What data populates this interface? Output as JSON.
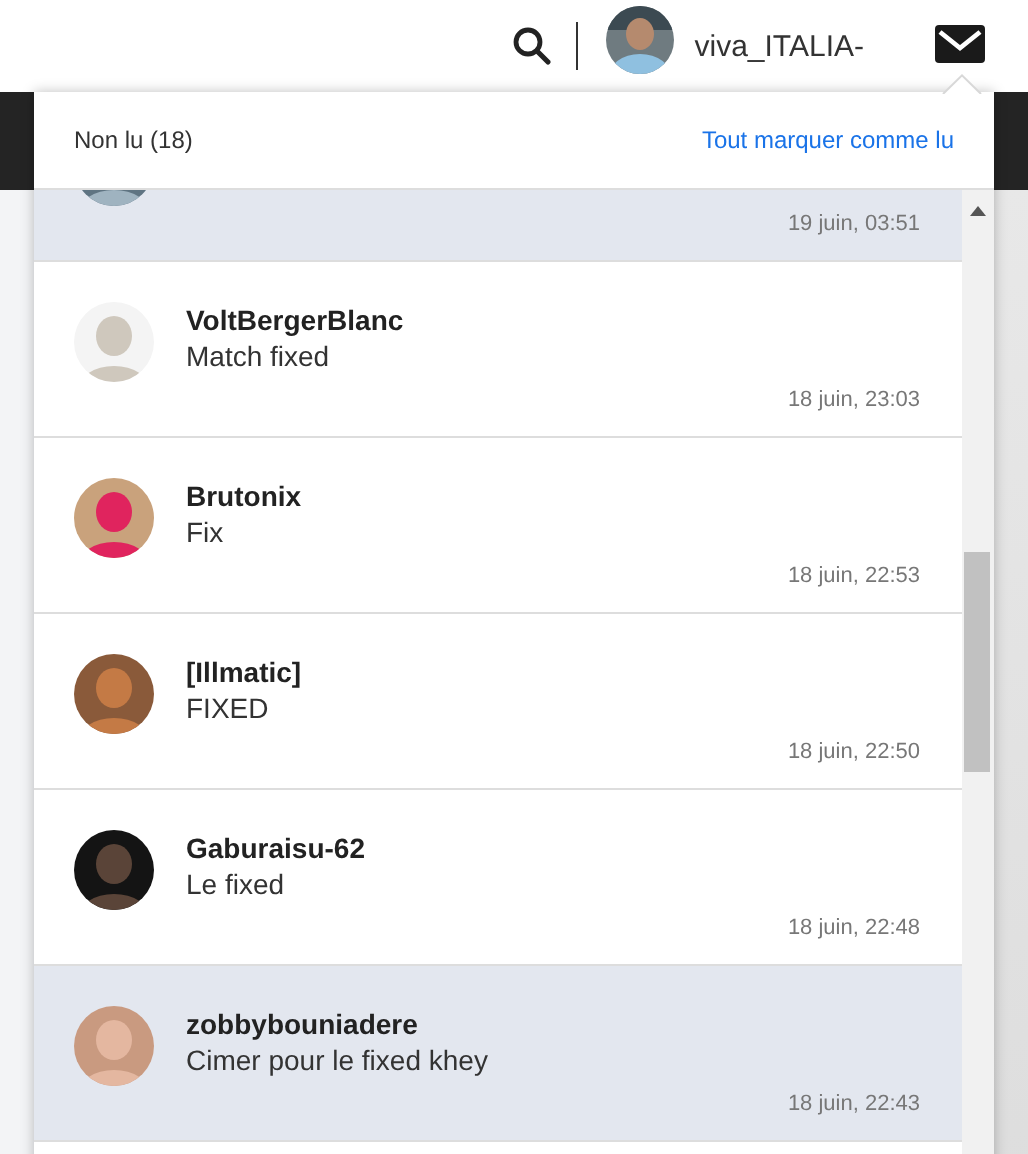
{
  "topbar": {
    "username": "viva_ITALIA-"
  },
  "notifications": {
    "title": "Non lu (18)",
    "mark_all": "Tout marquer comme lu",
    "items": [
      {
        "unread": true,
        "time": "19 juin, 03:51"
      },
      {
        "unread": false,
        "name": "VoltBergerBlanc",
        "message": "Match fixed",
        "time": "18 juin, 23:03"
      },
      {
        "unread": false,
        "name": "Brutonix",
        "message": "Fix",
        "time": "18 juin, 22:53"
      },
      {
        "unread": false,
        "name": "[Illmatic]",
        "message": "FIXED",
        "time": "18 juin, 22:50"
      },
      {
        "unread": false,
        "name": "Gaburaisu-62",
        "message": "Le fixed",
        "time": "18 juin, 22:48"
      },
      {
        "unread": true,
        "name": "zobbybouniadere",
        "message": "Cimer pour le fixed khey",
        "time": "18 juin, 22:43"
      },
      {
        "unread": false
      }
    ]
  }
}
